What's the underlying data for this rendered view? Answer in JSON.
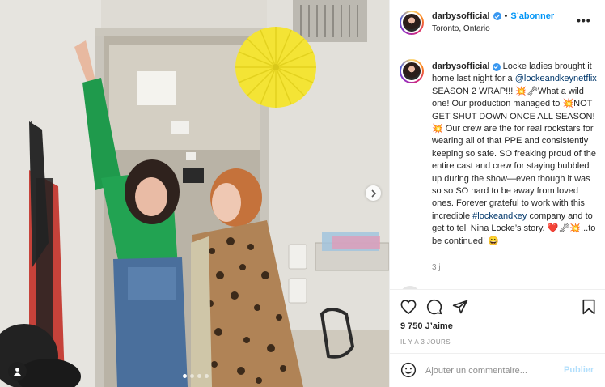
{
  "post": {
    "username": "darbysofficial",
    "follow_label": "S’abonner",
    "separator": "•",
    "location": "Toronto, Ontario",
    "more_label": "•••",
    "caption_parts": {
      "text1": "Locke ladies brought it home last night for a ",
      "mention": "@lockeandkeynetflix",
      "text2": " SEASON 2 WRAP!!! 💥🗝What a wild one! Our production managed to 💥NOT GET SHUT DOWN ONCE ALL SEASON! 💥 Our crew are the for real rockstars for wearing all of that PPE and consistently keeping so safe. SO freaking proud of the entire cast and crew for staying bubbled up during the show—even though it was so so SO hard to be away from loved ones. Forever grateful to work with this incredible ",
      "hashtag": "#lockeandkey",
      "text3": " company and to get to tell Nina Locke’s story. ❤️🗝💥...to be continued! 😀"
    },
    "caption_time": "3 j",
    "likes": "9 750 J’aime",
    "timestamp": "IL Y A 3 JOURS",
    "comment_placeholder": "Ajouter un commentaire...",
    "post_label": "Publier",
    "carousel": {
      "count": 4,
      "active_index": 0
    }
  },
  "icons": {
    "verified": "verified-badge-icon",
    "like": "heart-icon",
    "comment": "comment-bubble-icon",
    "share": "paper-plane-icon",
    "save": "bookmark-icon",
    "emoji": "smiley-icon",
    "next": "chevron-right-icon",
    "tag": "user-tag-icon"
  },
  "colors": {
    "accent": "#0095f6",
    "link": "#00376b",
    "muted": "#8e8e8e",
    "post_disabled": "#b2dffc",
    "green_top": "#1f9a4c",
    "fan_yellow": "#f6e63a"
  }
}
